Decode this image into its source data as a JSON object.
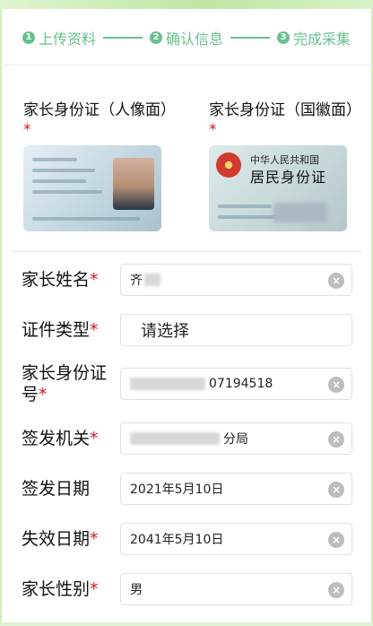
{
  "steps": [
    {
      "num": "1",
      "label": "上传资料"
    },
    {
      "num": "2",
      "label": "确认信息"
    },
    {
      "num": "3",
      "label": "完成采集"
    }
  ],
  "id_cards": {
    "front": {
      "title": "家长身份证（人像面）",
      "required": "*"
    },
    "back": {
      "title": "家长身份证（国徽面）",
      "required": "*",
      "text_line1": "中华人民共和国",
      "text_line2": "居民身份证"
    }
  },
  "form": {
    "name": {
      "label": "家长姓名",
      "required": "*",
      "value": "齐"
    },
    "id_type": {
      "label": "证件类型",
      "required": "*",
      "placeholder": "请选择"
    },
    "id_number": {
      "label": "家长身份证号",
      "required": "*",
      "value": "07194518"
    },
    "issuer": {
      "label": "签发机关",
      "required": "*",
      "value": "分局"
    },
    "issue_date": {
      "label": "签发日期",
      "value": "2021年5月10日"
    },
    "expiry_date": {
      "label": "失效日期",
      "required": "*",
      "value": "2041年5月10日"
    },
    "gender": {
      "label": "家长性别",
      "required": "*",
      "value": "男"
    }
  },
  "icons": {
    "clear": "clear-icon",
    "step_number": "step-number-icon"
  },
  "colors": {
    "accent": "#66c18c",
    "required": "#d0181f",
    "clear_bg": "#bdbdbd"
  }
}
